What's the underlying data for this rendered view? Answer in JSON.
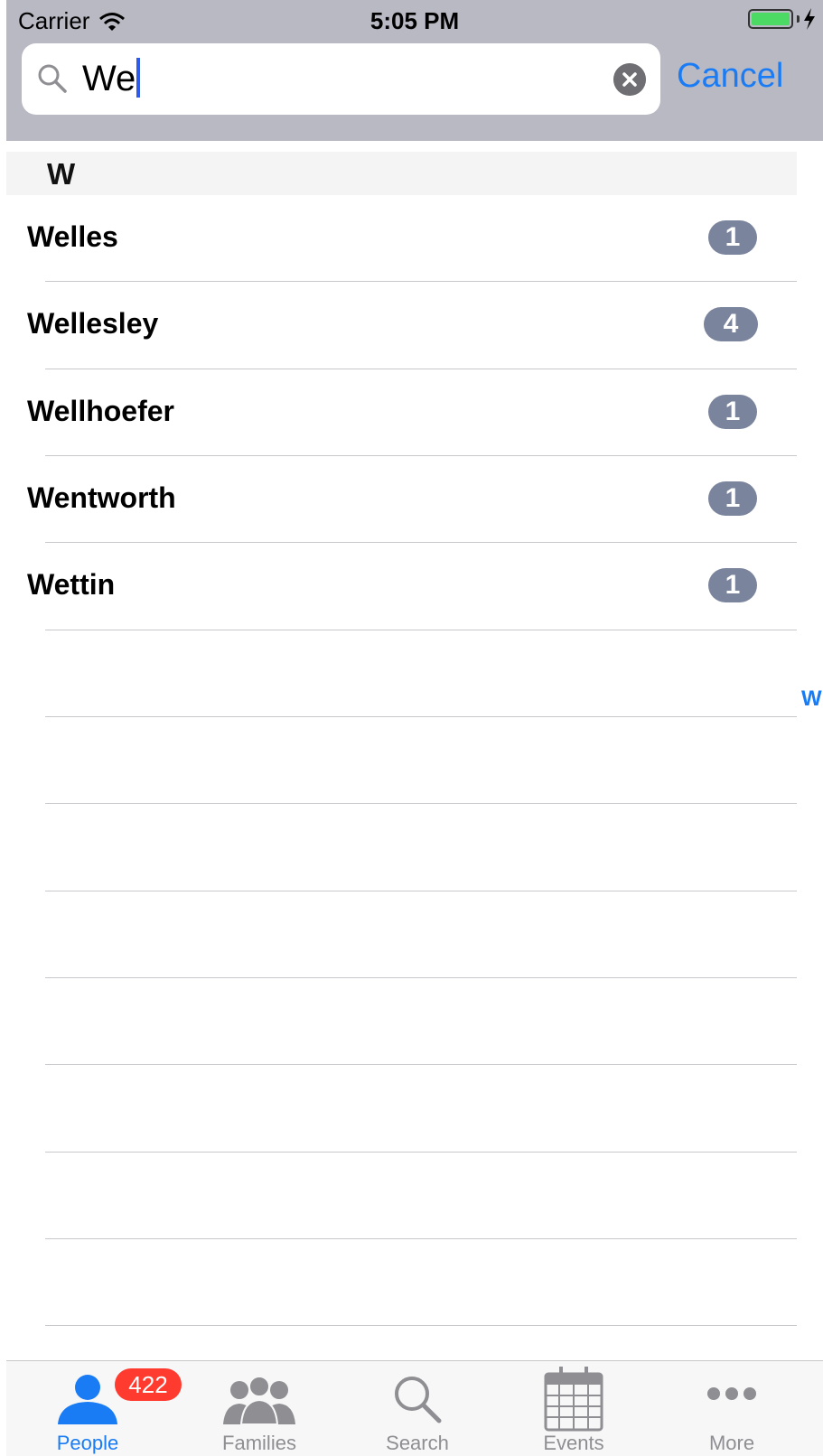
{
  "status_bar": {
    "carrier": "Carrier",
    "time": "5:05 PM"
  },
  "search": {
    "value": "We",
    "cancel_label": "Cancel"
  },
  "section": {
    "letter": "W"
  },
  "results": [
    {
      "name": "Welles",
      "count": "1"
    },
    {
      "name": "Wellesley",
      "count": "4"
    },
    {
      "name": "Wellhoefer",
      "count": "1"
    },
    {
      "name": "Wentworth",
      "count": "1"
    },
    {
      "name": "Wettin",
      "count": "1"
    }
  ],
  "index": {
    "letters": [
      "W"
    ]
  },
  "tabbar": {
    "tabs": [
      {
        "label": "People",
        "badge": "422",
        "icon": "person-icon",
        "active": true
      },
      {
        "label": "Families",
        "icon": "group-icon"
      },
      {
        "label": "Search",
        "icon": "search-icon"
      },
      {
        "label": "Events",
        "icon": "calendar-icon"
      },
      {
        "label": "More",
        "icon": "more-icon"
      }
    ]
  },
  "colors": {
    "accent": "#1a7cf5",
    "badge": "#7b849d",
    "tab_badge": "#ff3b30",
    "header": "#b9b9c4"
  }
}
